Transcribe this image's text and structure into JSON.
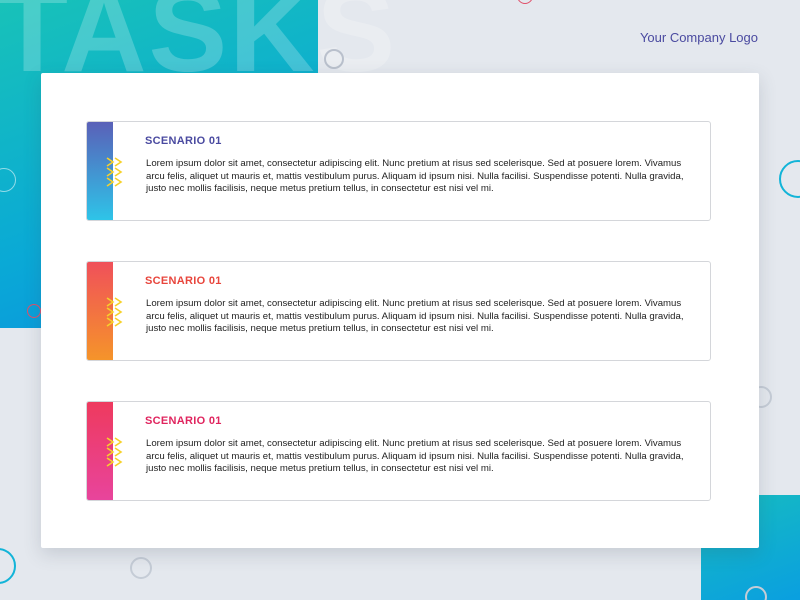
{
  "header": {
    "watermark": "TASKS",
    "logo": "Your Company Logo"
  },
  "colors": {
    "page_bg": "#e4e8ee",
    "accent_teal": "#0aa9d6",
    "logo_text": "#4a4aa0"
  },
  "tasks": [
    {
      "title": "SCENARIO 01",
      "title_color": "#4a4aa0",
      "stripe_top": "#5a60b8",
      "stripe_bottom": "#2ec4e8",
      "chevron_icon": "chevron-stack-icon",
      "body": "Lorem ipsum dolor sit amet, consectetur adipiscing elit. Nunc pretium at risus sed scelerisque. Sed at posuere lorem. Vivamus arcu felis, aliquet ut mauris et, mattis vestibulum purus. Aliquam id ipsum nisi. Nulla facilisi. Suspendisse potenti. Nulla gravida, justo nec mollis facilisis, neque metus pretium tellus, in consectetur est nisi vel mi."
    },
    {
      "title": "SCENARIO 01",
      "title_color": "#e8453c",
      "stripe_top": "#f0505a",
      "stripe_bottom": "#f5942a",
      "chevron_icon": "chevron-stack-icon",
      "body": "Lorem ipsum dolor sit amet, consectetur adipiscing elit. Nunc pretium at risus sed scelerisque. Sed at posuere lorem. Vivamus arcu felis, aliquet ut mauris et, mattis vestibulum purus. Aliquam id ipsum nisi. Nulla facilisi. Suspendisse potenti. Nulla gravida, justo nec mollis facilisis, neque metus pretium tellus, in consectetur est nisi vel mi."
    },
    {
      "title": "SCENARIO 01",
      "title_color": "#e0245e",
      "stripe_top": "#ee3a5e",
      "stripe_bottom": "#e8449c",
      "chevron_icon": "chevron-stack-icon",
      "body": "Lorem ipsum dolor sit amet, consectetur adipiscing elit. Nunc pretium at risus sed scelerisque. Sed at posuere lorem. Vivamus arcu felis, aliquet ut mauris et, mattis vestibulum purus. Aliquam id ipsum nisi. Nulla facilisi. Suspendisse potenti. Nulla gravida, justo nec mollis facilisis, neque metus pretium tellus, in consectetur est nisi vel mi."
    }
  ]
}
